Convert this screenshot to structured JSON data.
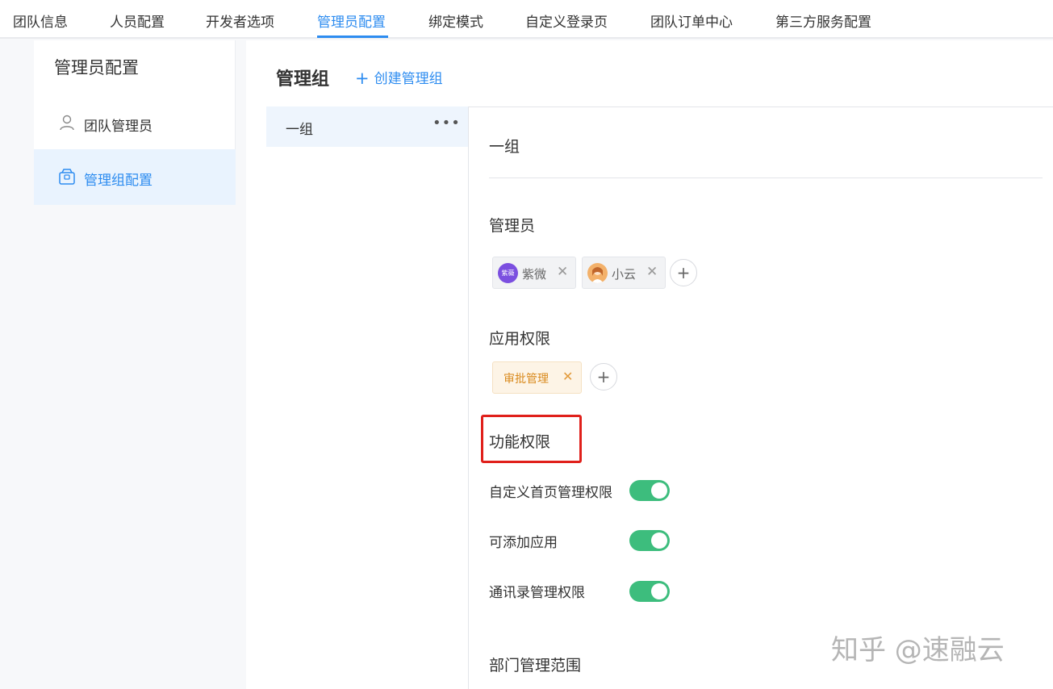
{
  "top_tabs": [
    {
      "label": "团队信息"
    },
    {
      "label": "人员配置"
    },
    {
      "label": "开发者选项"
    },
    {
      "label": "管理员配置",
      "active": true
    },
    {
      "label": "绑定模式"
    },
    {
      "label": "自定义登录页"
    },
    {
      "label": "团队订单中心"
    },
    {
      "label": "第三方服务配置"
    }
  ],
  "subsidebar": {
    "title": "管理员配置",
    "items": [
      {
        "label": "团队管理员",
        "icon": "user-icon"
      },
      {
        "label": "管理组配置",
        "icon": "box-icon",
        "active": true
      }
    ]
  },
  "main": {
    "title": "管理组",
    "create_label": "创建管理组",
    "groups": [
      {
        "name": "一组",
        "more": "•••"
      }
    ],
    "detail": {
      "group_name": "一组",
      "admins_label": "管理员",
      "admins": [
        {
          "name": "紫微",
          "avatar_text": "紫薇",
          "avatar_color": "#7b4fe0"
        },
        {
          "name": "小云",
          "avatar_text": "",
          "avatar_color": "#f0a050"
        }
      ],
      "app_perm_label": "应用权限",
      "apps": [
        {
          "name": "审批管理"
        }
      ],
      "func_perm_label": "功能权限",
      "permissions": [
        {
          "label": "自定义首页管理权限",
          "enabled": true
        },
        {
          "label": "可添加应用",
          "enabled": true
        },
        {
          "label": "通讯录管理权限",
          "enabled": true
        }
      ],
      "dept_scope_label": "部门管理范围"
    }
  },
  "watermark": "知乎 @速融云",
  "colors": {
    "accent": "#2d8cf0",
    "toggle_on": "#3dbd7d",
    "highlight_box": "#e0201b",
    "tag_text": "#d98a1d"
  }
}
